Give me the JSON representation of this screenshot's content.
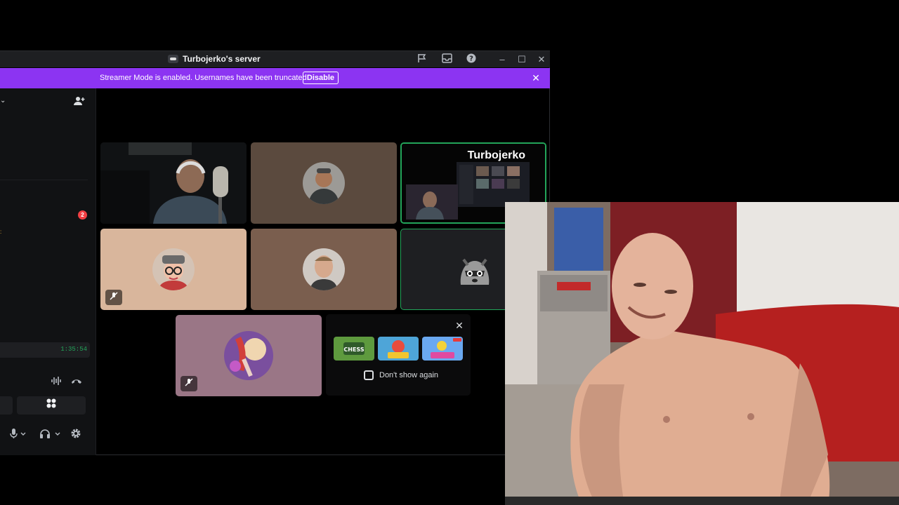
{
  "window": {
    "title": "Turbojerko's server",
    "titlebar_icons": [
      "flag-icon",
      "inbox-icon",
      "help-icon"
    ],
    "controls": {
      "minimize": "–",
      "maximize": "☐",
      "close": "✕"
    }
  },
  "banner": {
    "message": "Streamer Mode is enabled. Usernames have been truncated.",
    "button_label": "Disable",
    "close_glyph": "✕"
  },
  "sidebar": {
    "chevron": "⌄",
    "mention_count": "2",
    "side_marks": [
      ":",
      "s"
    ],
    "call_timer": "1:35:54",
    "voice_controls": [
      "soundboard-icon",
      "disconnect-icon"
    ],
    "activity_icon": "activities-icon",
    "user_controls": [
      "microphone-icon",
      "headphones-icon",
      "settings-icon"
    ]
  },
  "stream": {
    "name": "Turbojerko"
  },
  "activity_card": {
    "checkbox_label": "Don't show again",
    "checked": false,
    "games": [
      "chess-in-the-park",
      "jamspace",
      "putt-party"
    ]
  },
  "colors": {
    "banner": "#8c34f2",
    "speaking_border": "#23a55a",
    "mention_badge": "#f23f43",
    "timer": "#23a55a"
  }
}
